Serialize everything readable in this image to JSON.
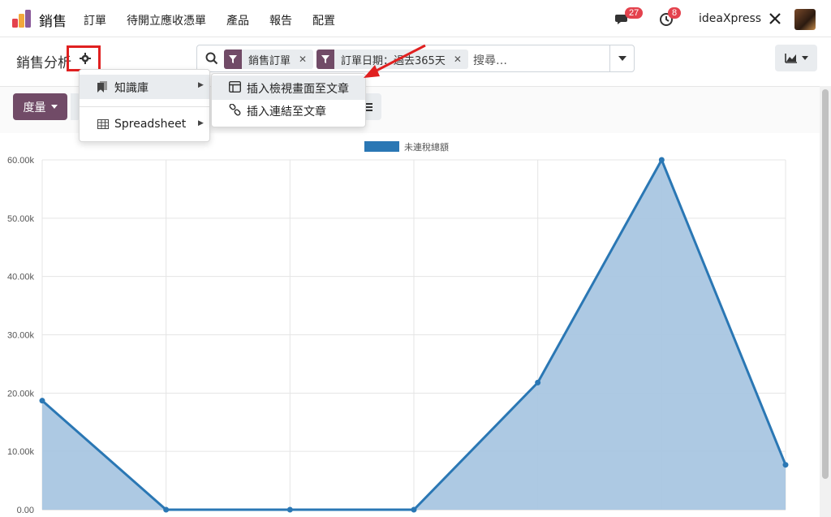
{
  "navbar": {
    "app_name": "銷售",
    "menu": [
      "訂單",
      "待開立應收憑單",
      "產品",
      "報告",
      "配置"
    ],
    "messages_count": "27",
    "activities_count": "8",
    "company": "ideaXpress"
  },
  "control_panel": {
    "title": "銷售分析",
    "facets": [
      {
        "label": "銷售訂單"
      },
      {
        "label": "訂單日期：過去365天"
      }
    ],
    "search_placeholder": "搜尋…"
  },
  "toolbar": {
    "measures_label": "度量"
  },
  "gear_menu": {
    "items": [
      {
        "label": "知識庫",
        "icon": "bookmark-icon"
      },
      {
        "label": "Spreadsheet",
        "icon": "table-icon"
      }
    ]
  },
  "knowledge_submenu": {
    "items": [
      {
        "label": "插入檢視畫面至文章",
        "icon": "window-icon"
      },
      {
        "label": "插入連結至文章",
        "icon": "link-icon"
      }
    ]
  },
  "colors": {
    "brand": "#714b67",
    "series": "#2a77b4",
    "series_fill": "#a9c6e2",
    "annotation": "#e02020"
  },
  "chart_data": {
    "type": "area",
    "legend_position": "top-center",
    "grid": true,
    "series": [
      {
        "name": "未連稅總額",
        "values": [
          18700,
          0,
          0,
          0,
          21800,
          60000,
          7700
        ]
      }
    ],
    "ylim": [
      0,
      60000
    ],
    "yticks": [
      "0.00",
      "10.00k",
      "20.00k",
      "30.00k",
      "40.00k",
      "50.00k",
      "60.00k"
    ],
    "ytick_values": [
      0,
      10000,
      20000,
      30000,
      40000,
      50000,
      60000
    ]
  }
}
